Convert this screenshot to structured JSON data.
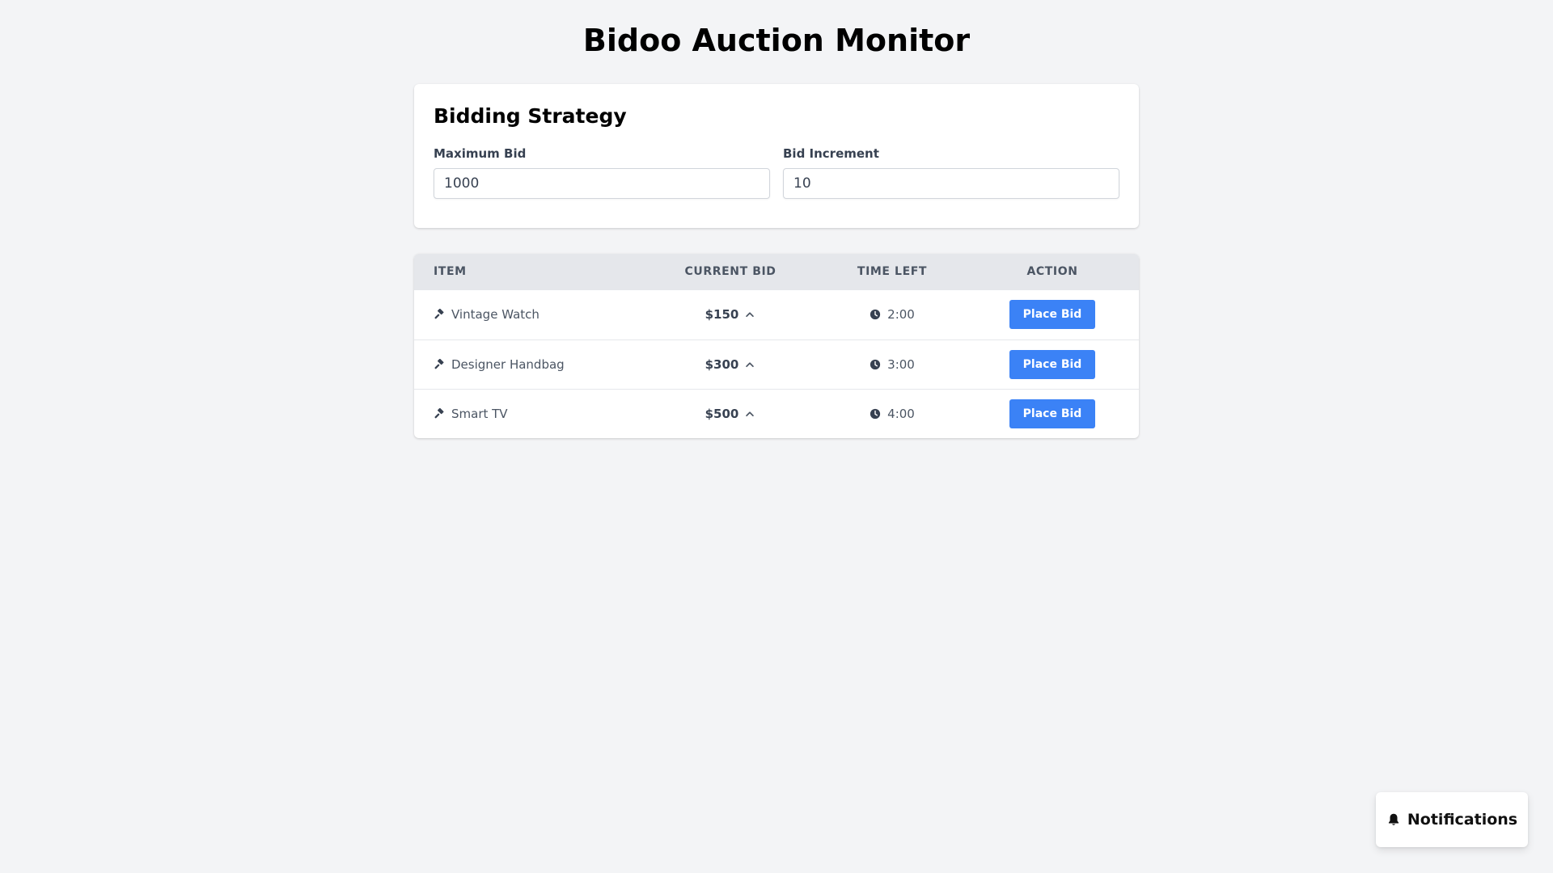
{
  "app": {
    "title": "Bidoo Auction Monitor"
  },
  "strategy": {
    "title": "Bidding Strategy",
    "max_bid": {
      "label": "Maximum Bid",
      "value": "1000"
    },
    "bid_increment": {
      "label": "Bid Increment",
      "value": "10"
    }
  },
  "table": {
    "headers": {
      "item": "ITEM",
      "current_bid": "CURRENT BID",
      "time_left": "TIME LEFT",
      "action": "ACTION"
    },
    "rows": [
      {
        "item": "Vintage Watch",
        "current_bid": "$150",
        "time_left": "2:00",
        "action_label": "Place Bid"
      },
      {
        "item": "Designer Handbag",
        "current_bid": "$300",
        "time_left": "3:00",
        "action_label": "Place Bid"
      },
      {
        "item": "Smart TV",
        "current_bid": "$500",
        "time_left": "4:00",
        "action_label": "Place Bid"
      }
    ]
  },
  "notifications": {
    "label": "Notifications"
  },
  "icons": {
    "item": "gavel-icon",
    "bid_trend": "chevron-up-icon",
    "time": "clock-icon",
    "notifications": "bell-icon"
  },
  "colors": {
    "primary": "#3b82f6",
    "background": "#f3f4f6",
    "header_bg": "#e5e7eb"
  }
}
